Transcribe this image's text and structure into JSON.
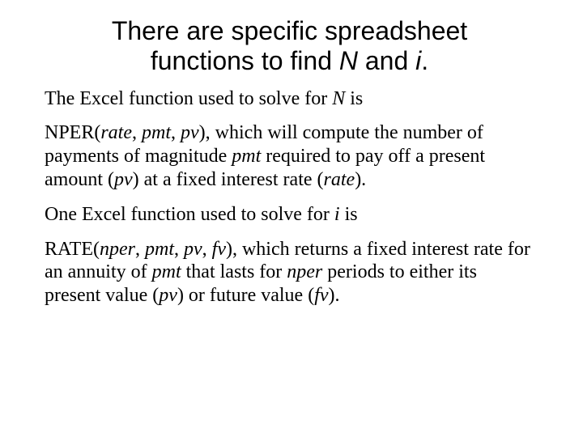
{
  "title": {
    "line1": "There are specific spreadsheet",
    "line2_a": "functions to find ",
    "line2_N": "N",
    "line2_b": " and ",
    "line2_i": "i",
    "line2_c": "."
  },
  "body": {
    "p1_a": "The Excel function used to solve for ",
    "p1_N": "N",
    "p1_b": " is",
    "p2_a": "NPER(",
    "p2_b": "rate",
    "p2_c": ", ",
    "p2_d": "pmt",
    "p2_e": ", ",
    "p2_f": "pv",
    "p2_g": "), which will compute the number of payments of magnitude ",
    "p2_h": "pmt",
    "p2_i": " required to pay off a present amount (",
    "p2_j": "pv",
    "p2_k": ") at a fixed interest rate (",
    "p2_l": "rate",
    "p2_m": ").",
    "p3_a": "One Excel function used to solve for ",
    "p3_i": "i",
    "p3_b": " is",
    "p4_a": "RATE(",
    "p4_b": "nper",
    "p4_c": ", ",
    "p4_d": "pmt",
    "p4_e": ", ",
    "p4_f": "pv",
    "p4_g": ", ",
    "p4_h": "fv",
    "p4_i": "), which returns a fixed interest rate for an annuity of ",
    "p4_j": "pmt",
    "p4_k": " that lasts for ",
    "p4_l": "nper",
    "p4_m": " periods to either its present value (",
    "p4_n": "pv",
    "p4_o": ") or future value (",
    "p4_p": "fv",
    "p4_q": ")."
  }
}
